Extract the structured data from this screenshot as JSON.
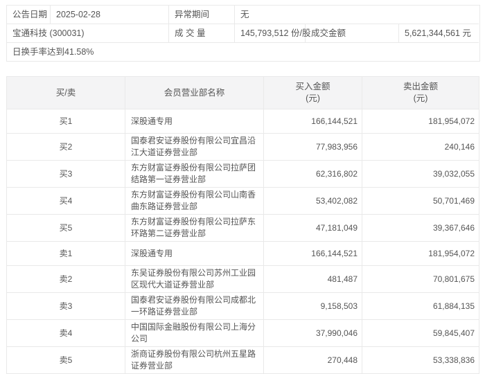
{
  "info": {
    "announce_label": "公告日期",
    "announce_date": "2025-02-28",
    "abnormal_label": "异常期间",
    "abnormal_value": "无",
    "stock_name_code": "宝通科技 (300031)",
    "volume_label": "成 交 量",
    "volume_value": "145,793,512 份/股",
    "amount_label": "成交金额",
    "amount_value": "5,621,344,561 元",
    "reason_note": "日换手率达到41.58%"
  },
  "table": {
    "headers": {
      "side": "买/卖",
      "branch": "会员营业部名称",
      "buy_line1": "买入金额",
      "buy_line2": "(元)",
      "sell_line1": "卖出金额",
      "sell_line2": "(元)"
    },
    "rows": [
      {
        "side": "买1",
        "branch": "深股通专用",
        "buy": "166,144,521",
        "sell": "181,954,072"
      },
      {
        "side": "买2",
        "branch": "国泰君安证券股份有限公司宜昌沿江大道证券营业部",
        "buy": "77,983,956",
        "sell": "240,146"
      },
      {
        "side": "买3",
        "branch": "东方财富证券股份有限公司拉萨团结路第一证券营业部",
        "buy": "62,316,802",
        "sell": "39,032,055"
      },
      {
        "side": "买4",
        "branch": "东方财富证券股份有限公司山南香曲东路证券营业部",
        "buy": "53,402,082",
        "sell": "50,701,469"
      },
      {
        "side": "买5",
        "branch": "东方财富证券股份有限公司拉萨东环路第二证券营业部",
        "buy": "47,181,049",
        "sell": "39,367,646"
      },
      {
        "side": "卖1",
        "branch": "深股通专用",
        "buy": "166,144,521",
        "sell": "181,954,072"
      },
      {
        "side": "卖2",
        "branch": "东吴证券股份有限公司苏州工业园区现代大道证券营业部",
        "buy": "481,487",
        "sell": "70,801,675"
      },
      {
        "side": "卖3",
        "branch": "国泰君安证券股份有限公司成都北一环路证券营业部",
        "buy": "9,158,503",
        "sell": "61,884,135"
      },
      {
        "side": "卖4",
        "branch": "中国国际金融股份有限公司上海分公司",
        "buy": "37,990,046",
        "sell": "59,845,407"
      },
      {
        "side": "卖5",
        "branch": "浙商证券股份有限公司杭州五星路证券营业部",
        "buy": "270,448",
        "sell": "53,338,836"
      }
    ]
  },
  "colors": {
    "header_bg": "#f4f4f5",
    "border": "#e9e9e9",
    "text": "#555555",
    "background": "#ffffff"
  }
}
